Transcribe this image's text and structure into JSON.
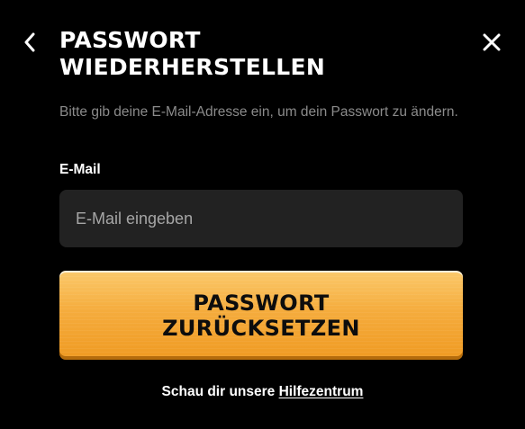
{
  "header": {
    "back_icon": "chevron-left-icon",
    "close_icon": "close-icon",
    "title_line1": "PASSWORT",
    "title_line2": "WIEDERHERSTELLEN"
  },
  "form": {
    "instruction": "Bitte gib deine E-Mail-Adresse ein, um dein Passwort zu ändern.",
    "email_label": "E-Mail",
    "email_value": "",
    "email_placeholder": "E-Mail eingeben",
    "submit_line1": "PASSWORT",
    "submit_line2": "ZURÜCKSETZEN"
  },
  "footer": {
    "help_prefix": "Schau dir unsere ",
    "help_link": "Hilfezentrum"
  },
  "colors": {
    "background": "#000000",
    "input_background": "#222222",
    "button_accent": "#f5ac3d",
    "muted_text": "#8b8b8b"
  }
}
